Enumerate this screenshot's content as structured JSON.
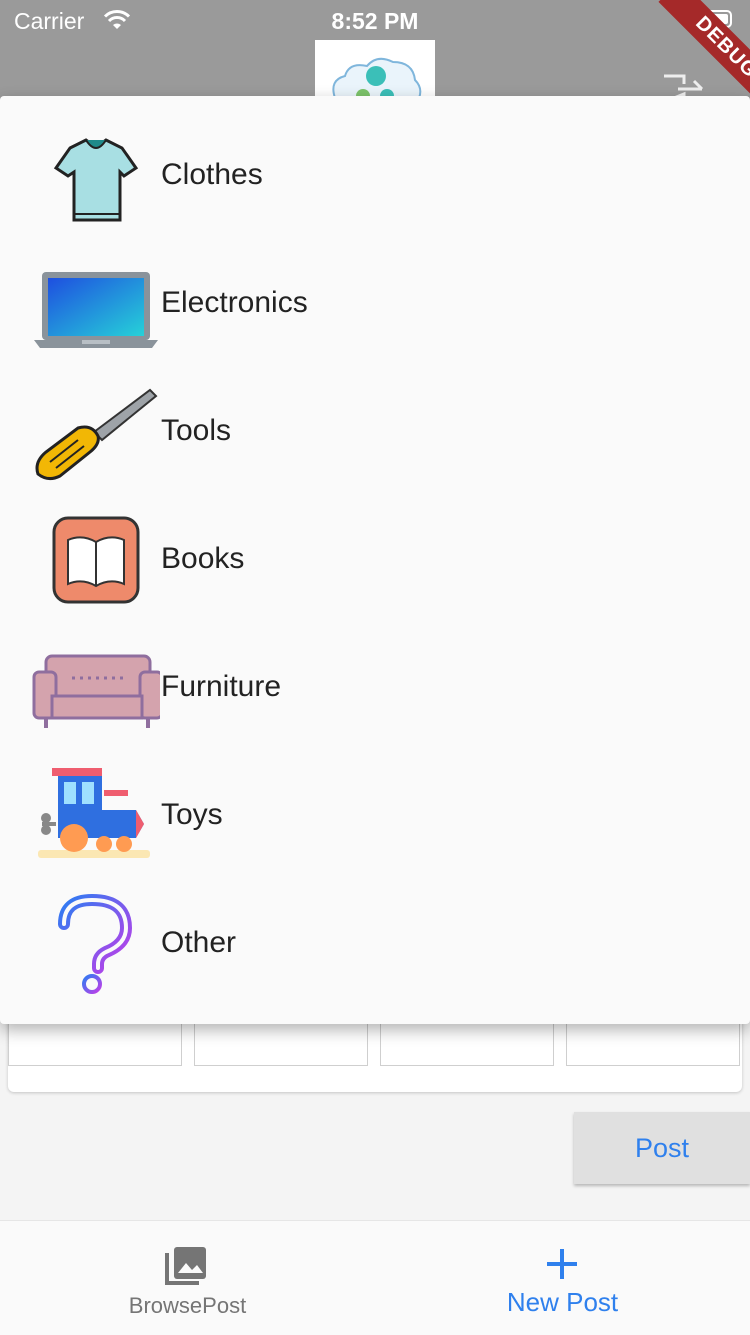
{
  "status_bar": {
    "carrier": "Carrier",
    "time": "8:52 PM"
  },
  "debug_banner": "DEBUG",
  "category_menu": {
    "items": [
      {
        "label": "Clothes",
        "icon": "tshirt-icon"
      },
      {
        "label": "Electronics",
        "icon": "laptop-icon"
      },
      {
        "label": "Tools",
        "icon": "screwdriver-icon"
      },
      {
        "label": "Books",
        "icon": "book-icon"
      },
      {
        "label": "Furniture",
        "icon": "sofa-icon"
      },
      {
        "label": "Toys",
        "icon": "toy-train-icon"
      },
      {
        "label": "Other",
        "icon": "question-mark-icon"
      }
    ]
  },
  "form": {
    "post_label": "Post"
  },
  "bottom_nav": {
    "items": [
      {
        "label": "BrowsePost",
        "icon": "photo-library-icon",
        "color": "#757575"
      },
      {
        "label": "New Post",
        "icon": "plus-icon",
        "color": "#2f80ed",
        "active": true
      }
    ]
  }
}
